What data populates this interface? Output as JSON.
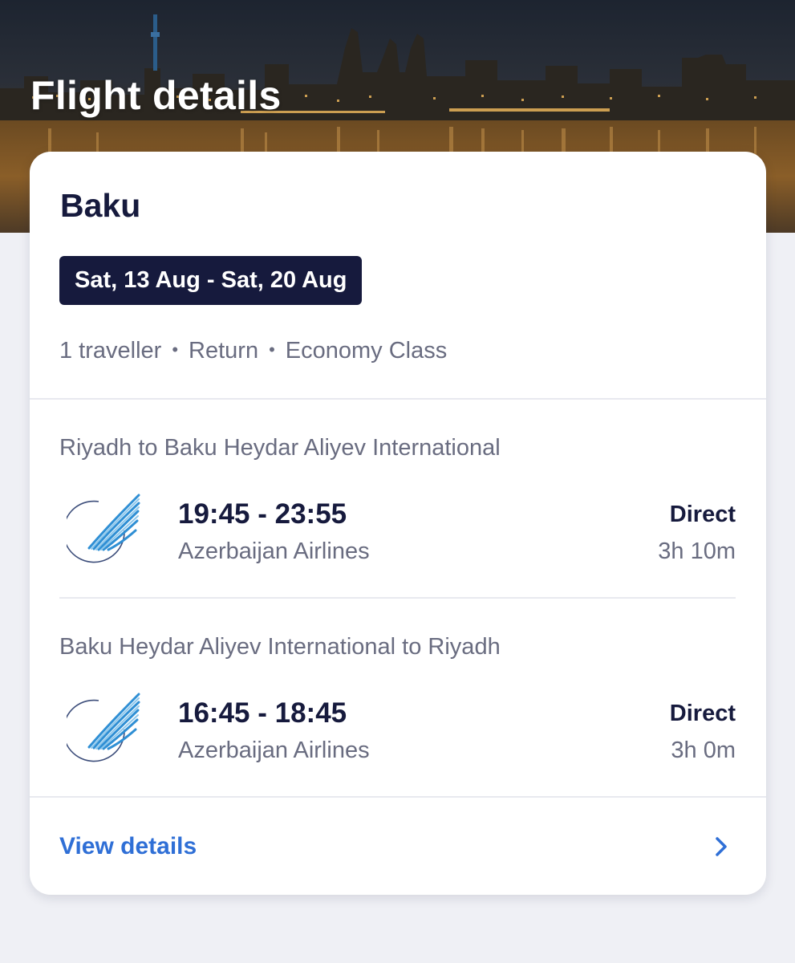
{
  "header": {
    "title": "Flight details",
    "background": "baku-night-skyline-image"
  },
  "trip": {
    "destination": "Baku",
    "dates": "Sat, 13 Aug - Sat, 20 Aug",
    "travellers": "1 traveller",
    "trip_type": "Return",
    "cabin_class": "Economy Class",
    "separator": "•"
  },
  "flights": [
    {
      "route": "Riyadh to Baku Heydar Aliyev International",
      "times": "19:45 - 23:55",
      "airline": "Azerbaijan Airlines",
      "stops": "Direct",
      "duration": "3h 10m",
      "logo_icon": "azerbaijan-airlines-logo-icon"
    },
    {
      "route": "Baku Heydar Aliyev International to Riyadh",
      "times": "16:45 - 18:45",
      "airline": "Azerbaijan Airlines",
      "stops": "Direct",
      "duration": "3h 0m",
      "logo_icon": "azerbaijan-airlines-logo-icon"
    }
  ],
  "footer": {
    "view_details_label": "View details",
    "chevron_icon": "chevron-right-icon"
  },
  "colors": {
    "navy": "#161a3d",
    "muted_text": "#696c80",
    "link_blue": "#2f6fd6",
    "page_background": "#eff0f5",
    "logo_blue": "#2f8fd4"
  }
}
